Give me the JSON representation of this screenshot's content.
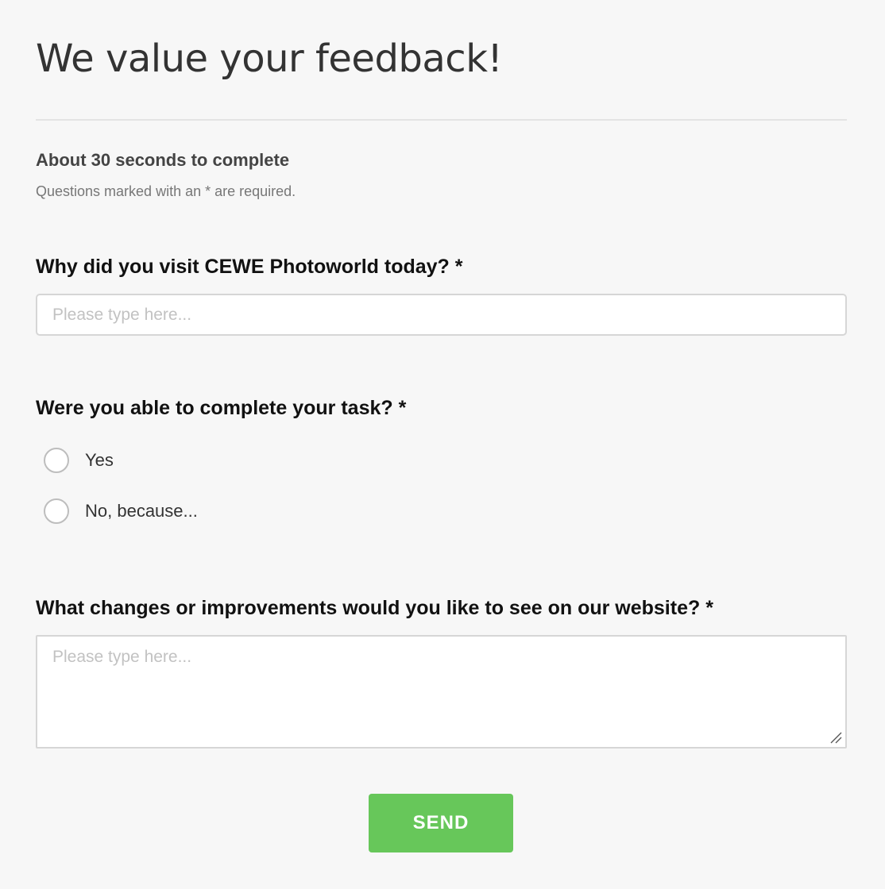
{
  "header": {
    "title": "We value your feedback!"
  },
  "intro": {
    "subtitle": "About 30 seconds to complete",
    "required_note": "Questions marked with an * are required."
  },
  "questions": [
    {
      "label": "Why did you visit CEWE Photoworld today? *",
      "placeholder": "Please type here...",
      "value": ""
    },
    {
      "label": "Were you able to complete your task? *",
      "options": [
        {
          "label": "Yes",
          "selected": false
        },
        {
          "label": "No, because...",
          "selected": false
        }
      ]
    },
    {
      "label": "What changes or improvements would you like to see on our website? *",
      "placeholder": "Please type here...",
      "value": ""
    }
  ],
  "actions": {
    "send_label": "SEND"
  },
  "colors": {
    "background": "#f7f7f7",
    "accent": "#67c75a",
    "input_border": "#d6d6d6",
    "placeholder": "#c2c2c2"
  },
  "icons": {
    "resize_handle": "resize-handle-icon"
  }
}
